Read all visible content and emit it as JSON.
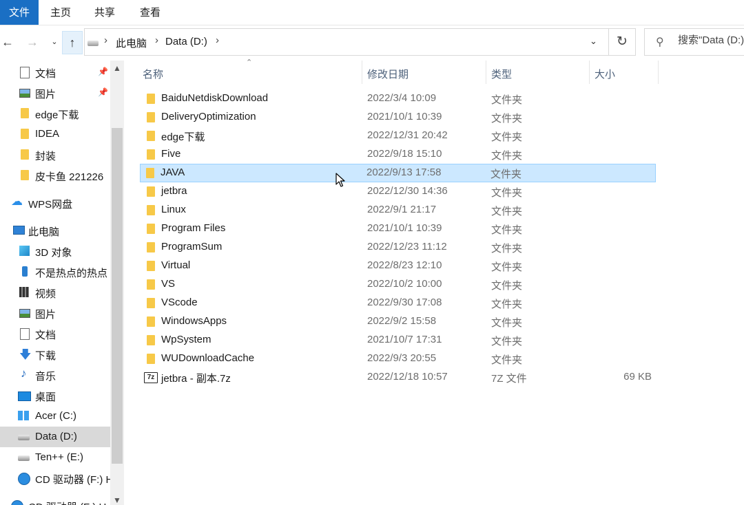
{
  "ribbon": {
    "tabs": [
      "文件",
      "主页",
      "共享",
      "查看"
    ]
  },
  "nav": {
    "back_icon": "arrow-left-icon",
    "forward_icon": "arrow-right-icon",
    "recent_icon": "chevron-down-icon",
    "up_icon": "arrow-up-icon",
    "breadcrumb": [
      "此电脑",
      "Data (D:)"
    ],
    "refresh_icon": "refresh-icon",
    "search_placeholder": "搜索\"Data (D:)\""
  },
  "sidebar": {
    "items": [
      {
        "label": "文档",
        "icon": "document-icon",
        "pinned": true
      },
      {
        "label": "图片",
        "icon": "pictures-icon",
        "pinned": true
      },
      {
        "label": "edge下载",
        "icon": "folder-icon"
      },
      {
        "label": "IDEA",
        "icon": "folder-icon"
      },
      {
        "label": "封装",
        "icon": "folder-icon"
      },
      {
        "label": "皮卡鱼 221226",
        "icon": "folder-icon"
      },
      {
        "label": "WPS网盘",
        "icon": "cloud-icon"
      },
      {
        "label": "此电脑",
        "icon": "computer-icon"
      },
      {
        "label": "3D 对象",
        "icon": "3d-objects-icon"
      },
      {
        "label": "不是热点的热点",
        "icon": "phone-icon"
      },
      {
        "label": "视频",
        "icon": "video-icon"
      },
      {
        "label": "图片",
        "icon": "pictures-icon"
      },
      {
        "label": "文档",
        "icon": "document-icon"
      },
      {
        "label": "下载",
        "icon": "download-icon"
      },
      {
        "label": "音乐",
        "icon": "music-icon"
      },
      {
        "label": "桌面",
        "icon": "desktop-icon"
      },
      {
        "label": "Acer (C:)",
        "icon": "windows-drive-icon"
      },
      {
        "label": "Data (D:)",
        "icon": "drive-icon",
        "selected": true
      },
      {
        "label": "Ten++ (E:)",
        "icon": "drive-icon"
      },
      {
        "label": "CD 驱动器 (F:) H",
        "icon": "cd-drive-icon"
      },
      {
        "label": "CD 驱动器 (F:) Hu",
        "icon": "cd-drive-icon"
      }
    ]
  },
  "columns": {
    "name": "名称",
    "date": "修改日期",
    "type": "类型",
    "size": "大小"
  },
  "files": [
    {
      "name": "BaiduNetdiskDownload",
      "date": "2022/3/4 10:09",
      "type": "文件夹",
      "size": ""
    },
    {
      "name": "DeliveryOptimization",
      "date": "2021/10/1 10:39",
      "type": "文件夹",
      "size": ""
    },
    {
      "name": "edge下载",
      "date": "2022/12/31 20:42",
      "type": "文件夹",
      "size": ""
    },
    {
      "name": "Five",
      "date": "2022/9/18 15:10",
      "type": "文件夹",
      "size": ""
    },
    {
      "name": "JAVA",
      "date": "2022/9/13 17:58",
      "type": "文件夹",
      "size": "",
      "selected": true
    },
    {
      "name": "jetbra",
      "date": "2022/12/30 14:36",
      "type": "文件夹",
      "size": ""
    },
    {
      "name": "Linux",
      "date": "2022/9/1 21:17",
      "type": "文件夹",
      "size": ""
    },
    {
      "name": "Program Files",
      "date": "2021/10/1 10:39",
      "type": "文件夹",
      "size": ""
    },
    {
      "name": "ProgramSum",
      "date": "2022/12/23 11:12",
      "type": "文件夹",
      "size": ""
    },
    {
      "name": "Virtual",
      "date": "2022/8/23 12:10",
      "type": "文件夹",
      "size": ""
    },
    {
      "name": "VS",
      "date": "2022/10/2 10:00",
      "type": "文件夹",
      "size": ""
    },
    {
      "name": "VScode",
      "date": "2022/9/30 17:08",
      "type": "文件夹",
      "size": ""
    },
    {
      "name": "WindowsApps",
      "date": "2022/9/2 15:58",
      "type": "文件夹",
      "size": ""
    },
    {
      "name": "WpSystem",
      "date": "2021/10/7 17:31",
      "type": "文件夹",
      "size": ""
    },
    {
      "name": "WUDownloadCache",
      "date": "2022/9/3 20:55",
      "type": "文件夹",
      "size": ""
    },
    {
      "name": "jetbra - 副本.7z",
      "date": "2022/12/18 10:57",
      "type": "7Z 文件",
      "size": "69 KB",
      "icon": "7z-archive-icon",
      "icon_text": "7z"
    }
  ]
}
